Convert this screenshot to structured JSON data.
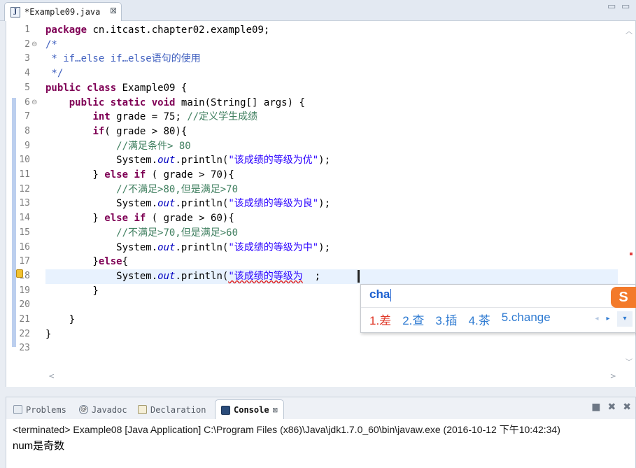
{
  "editor_tab": {
    "icon_letter": "J",
    "title": "*Example09.java",
    "close_glyph": "⊠"
  },
  "editor_window_controls": {
    "minimize": "▭",
    "maximize": "▭"
  },
  "code_lines": [
    {
      "num": "1",
      "fold": "",
      "segments": [
        {
          "t": "package",
          "c": "kw"
        },
        {
          "t": " cn.itcast.chapter02.example09;",
          "c": ""
        }
      ]
    },
    {
      "num": "2",
      "fold": "⊖",
      "segments": [
        {
          "t": "/*",
          "c": "jd"
        }
      ]
    },
    {
      "num": "3",
      "fold": "",
      "segments": [
        {
          "t": " * if…else if…else语句的使用",
          "c": "jd"
        }
      ]
    },
    {
      "num": "4",
      "fold": "",
      "segments": [
        {
          "t": " */",
          "c": "jd"
        }
      ]
    },
    {
      "num": "5",
      "fold": "",
      "segments": [
        {
          "t": "public",
          "c": "kw"
        },
        {
          "t": " ",
          "c": ""
        },
        {
          "t": "class",
          "c": "kw"
        },
        {
          "t": " Example09 {",
          "c": ""
        }
      ]
    },
    {
      "num": "6",
      "fold": "⊖",
      "segments": [
        {
          "t": "    ",
          "c": ""
        },
        {
          "t": "public",
          "c": "kw"
        },
        {
          "t": " ",
          "c": ""
        },
        {
          "t": "static",
          "c": "kw"
        },
        {
          "t": " ",
          "c": ""
        },
        {
          "t": "void",
          "c": "kw"
        },
        {
          "t": " main(String[] args) {",
          "c": ""
        }
      ]
    },
    {
      "num": "7",
      "fold": "",
      "segments": [
        {
          "t": "        ",
          "c": ""
        },
        {
          "t": "int",
          "c": "kw"
        },
        {
          "t": " grade = 75; ",
          "c": ""
        },
        {
          "t": "//定义学生成绩",
          "c": "cm"
        }
      ]
    },
    {
      "num": "8",
      "fold": "",
      "segments": [
        {
          "t": "        ",
          "c": ""
        },
        {
          "t": "if",
          "c": "kw"
        },
        {
          "t": "( grade > 80){",
          "c": ""
        }
      ]
    },
    {
      "num": "9",
      "fold": "",
      "segments": [
        {
          "t": "            ",
          "c": ""
        },
        {
          "t": "//满足条件> 80",
          "c": "cm"
        }
      ]
    },
    {
      "num": "10",
      "fold": "",
      "segments": [
        {
          "t": "            System.",
          "c": ""
        },
        {
          "t": "out",
          "c": "fi"
        },
        {
          "t": ".println(",
          "c": ""
        },
        {
          "t": "\"该成绩的等级为优\"",
          "c": "st"
        },
        {
          "t": ");",
          "c": ""
        }
      ]
    },
    {
      "num": "11",
      "fold": "",
      "segments": [
        {
          "t": "        } ",
          "c": ""
        },
        {
          "t": "else",
          "c": "kw"
        },
        {
          "t": " ",
          "c": ""
        },
        {
          "t": "if",
          "c": "kw"
        },
        {
          "t": " ( grade > 70){",
          "c": ""
        }
      ]
    },
    {
      "num": "12",
      "fold": "",
      "segments": [
        {
          "t": "            ",
          "c": ""
        },
        {
          "t": "//不满足>80,但是满足>70",
          "c": "cm"
        }
      ]
    },
    {
      "num": "13",
      "fold": "",
      "segments": [
        {
          "t": "            System.",
          "c": ""
        },
        {
          "t": "out",
          "c": "fi"
        },
        {
          "t": ".println(",
          "c": ""
        },
        {
          "t": "\"该成绩的等级为良\"",
          "c": "st"
        },
        {
          "t": ");",
          "c": ""
        }
      ]
    },
    {
      "num": "14",
      "fold": "",
      "segments": [
        {
          "t": "        } ",
          "c": ""
        },
        {
          "t": "else",
          "c": "kw"
        },
        {
          "t": " ",
          "c": ""
        },
        {
          "t": "if",
          "c": "kw"
        },
        {
          "t": " ( grade > 60){",
          "c": ""
        }
      ]
    },
    {
      "num": "15",
      "fold": "",
      "segments": [
        {
          "t": "            ",
          "c": ""
        },
        {
          "t": "//不满足>70,但是满足>60",
          "c": "cm"
        }
      ]
    },
    {
      "num": "16",
      "fold": "",
      "segments": [
        {
          "t": "            System.",
          "c": ""
        },
        {
          "t": "out",
          "c": "fi"
        },
        {
          "t": ".println(",
          "c": ""
        },
        {
          "t": "\"该成绩的等级为中\"",
          "c": "st"
        },
        {
          "t": ");",
          "c": ""
        }
      ]
    },
    {
      "num": "17",
      "fold": "",
      "segments": [
        {
          "t": "        }",
          "c": ""
        },
        {
          "t": "else",
          "c": "kw"
        },
        {
          "t": "{",
          "c": ""
        }
      ]
    },
    {
      "num": "18",
      "fold": "",
      "current": true,
      "segments": [
        {
          "t": "            System.",
          "c": ""
        },
        {
          "t": "out",
          "c": "fi"
        },
        {
          "t": ".println(",
          "c": ""
        },
        {
          "t": "\"该成绩的等级为",
          "c": "st squiggle"
        },
        {
          "t": "  ;",
          "c": ""
        }
      ]
    },
    {
      "num": "19",
      "fold": "",
      "segments": [
        {
          "t": "        }",
          "c": ""
        }
      ]
    },
    {
      "num": "20",
      "fold": "",
      "segments": []
    },
    {
      "num": "21",
      "fold": "",
      "segments": [
        {
          "t": "    }",
          "c": ""
        }
      ]
    },
    {
      "num": "22",
      "fold": "",
      "segments": [
        {
          "t": "}",
          "c": ""
        }
      ]
    },
    {
      "num": "23",
      "fold": "",
      "segments": []
    }
  ],
  "ime": {
    "input": "cha",
    "candidates": [
      "1.差",
      "2.查",
      "3.插",
      "4.茶",
      "5.change"
    ],
    "prev_glyph": "◂",
    "next_glyph": "▸",
    "more_glyph": "▾",
    "logo": "S"
  },
  "scroll": {
    "up": "︿",
    "down": "﹀",
    "left": "<",
    "right": ">"
  },
  "view_tabs": [
    {
      "id": "problems",
      "label": "Problems"
    },
    {
      "id": "javadoc",
      "label": "Javadoc",
      "icon_text": "@"
    },
    {
      "id": "declaration",
      "label": "Declaration"
    },
    {
      "id": "console",
      "label": "Console",
      "close": "⊠"
    }
  ],
  "console_toolbar": [
    "■",
    "✖",
    "✖"
  ],
  "console": {
    "header": "<terminated> Example08 [Java Application] C:\\Program Files (x86)\\Java\\jdk1.7.0_60\\bin\\javaw.exe (2016-10-12 下午10:42:34)",
    "output": "num是奇数"
  }
}
